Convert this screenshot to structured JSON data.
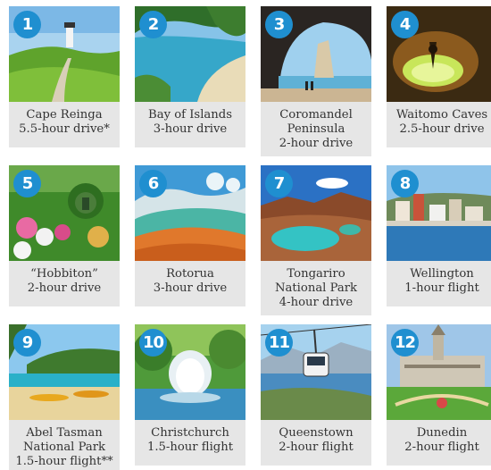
{
  "destinations": [
    {
      "number": "1",
      "lines": [
        "Cape Reinga",
        "5.5-hour drive*"
      ]
    },
    {
      "number": "2",
      "lines": [
        "Bay of Islands",
        "3-hour drive"
      ]
    },
    {
      "number": "3",
      "lines": [
        "Coromandel",
        "Peninsula",
        "2-hour drive"
      ]
    },
    {
      "number": "4",
      "lines": [
        "Waitomo Caves",
        "2.5-hour drive"
      ]
    },
    {
      "number": "5",
      "lines": [
        "“Hobbiton”",
        "2-hour drive"
      ]
    },
    {
      "number": "6",
      "lines": [
        "Rotorua",
        "3-hour drive"
      ]
    },
    {
      "number": "7",
      "lines": [
        "Tongariro",
        "National Park",
        "4-hour drive"
      ]
    },
    {
      "number": "8",
      "lines": [
        "Wellington",
        "1-hour flight"
      ]
    },
    {
      "number": "9",
      "lines": [
        "Abel Tasman",
        "National Park",
        "1.5-hour flight**"
      ]
    },
    {
      "number": "10",
      "lines": [
        "Christchurch",
        "1.5-hour flight"
      ]
    },
    {
      "number": "11",
      "lines": [
        "Queenstown",
        "2-hour flight"
      ]
    },
    {
      "number": "12",
      "lines": [
        "Dunedin",
        "2-hour flight"
      ]
    }
  ]
}
